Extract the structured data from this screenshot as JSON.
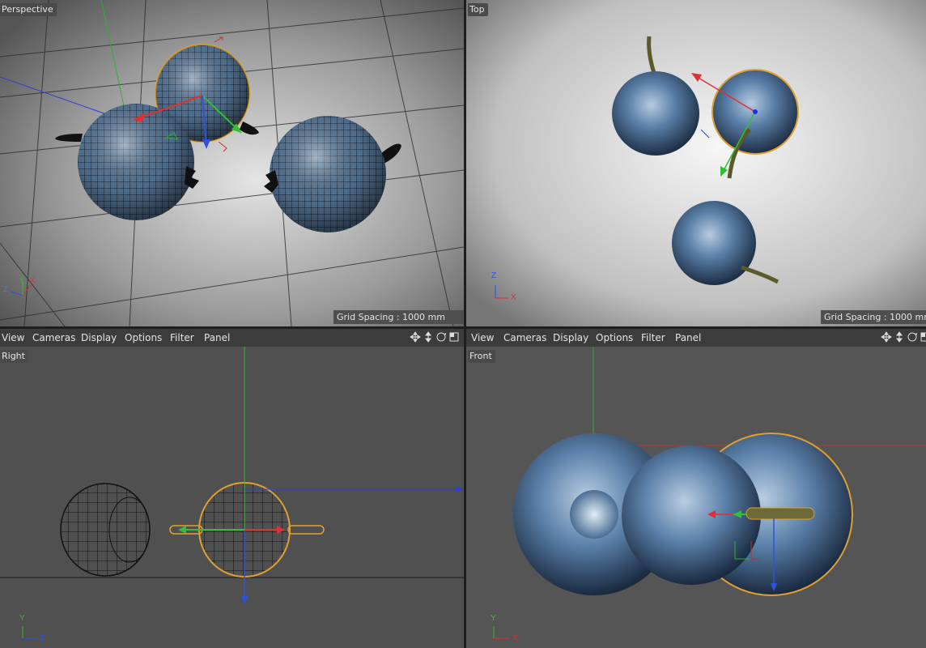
{
  "viewports": {
    "perspective": {
      "label": "Perspective",
      "grid": "Grid Spacing : 1000 mm"
    },
    "top": {
      "label": "Top",
      "grid": "Grid Spacing : 1000 mm"
    },
    "right": {
      "label": "Right"
    },
    "front": {
      "label": "Front"
    }
  },
  "menu": {
    "view": "View",
    "cameras": "Cameras",
    "display": "Display",
    "options": "Options",
    "filter": "Filter",
    "panel": "Panel"
  },
  "axis_labels": {
    "x": "X",
    "y": "Y",
    "z": "Z"
  },
  "colors": {
    "x_axis": "#e03030",
    "y_axis": "#30c030",
    "z_axis": "#3050e0",
    "selection": "#e0a030",
    "berry": "#4d6e93"
  },
  "icons": [
    "move-icon",
    "vertical-move-icon",
    "rotate-icon",
    "maximize-icon"
  ]
}
